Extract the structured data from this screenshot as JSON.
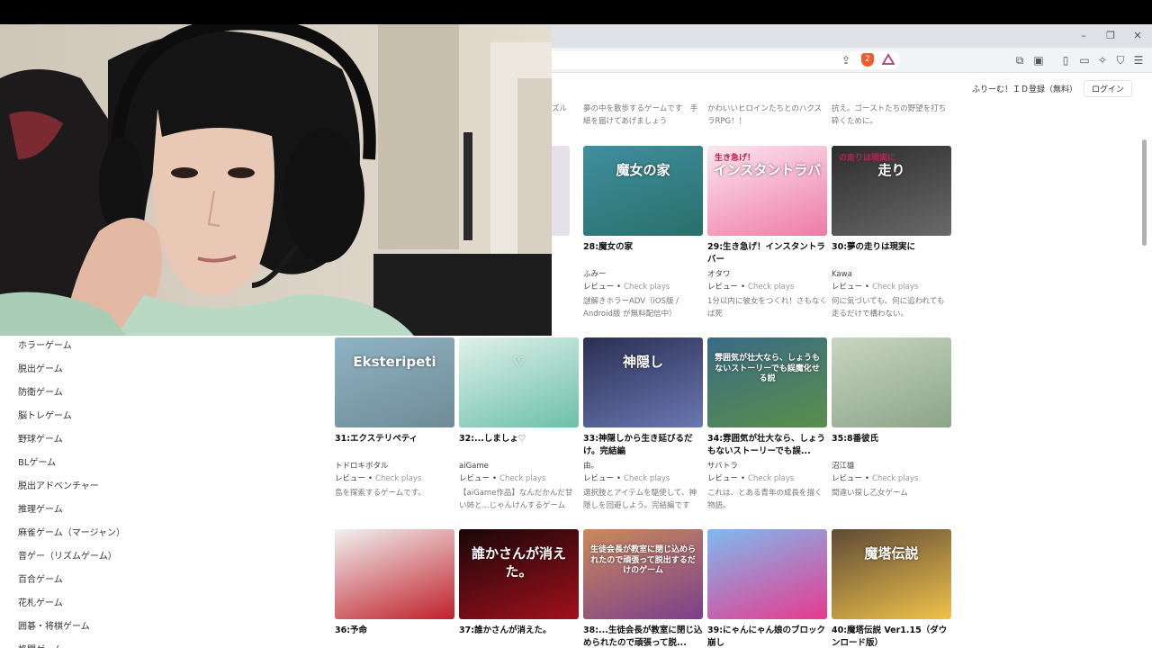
{
  "window_controls": {
    "minimize": "–",
    "maximize": "❐",
    "close": "✕"
  },
  "toolbar": {
    "brave_shield_count": "2",
    "icons": [
      "share-icon",
      "brave-shield-icon",
      "brave-rewards-icon",
      "extensions-icon",
      "reading-list-icon",
      "sidebar-icon",
      "wallet-icon",
      "leo-ai-icon",
      "vpn-icon",
      "menu-icon"
    ]
  },
  "site_header": {
    "register": "ふりーむ！ＩＤ登録（無料）",
    "login": "ログイン"
  },
  "sidebar": {
    "items": [
      "ホラーゲーム",
      "脱出ゲーム",
      "防衛ゲーム",
      "脳トレゲーム",
      "野球ゲーム",
      "BLゲーム",
      "脱出アドベンチャー",
      "推理ゲーム",
      "麻雀ゲーム（マージャン）",
      "音ゲー（リズムゲーム）",
      "百合ゲーム",
      "花札ゲーム",
      "囲碁・将棋ゲーム",
      "格闘ゲーム"
    ]
  },
  "top_row_descriptions": [
    {
      "text": "夢の中を散歩するゲームです　手紙を届けてあげましょう"
    },
    {
      "text": "かわいいヒロインたちとのハクスラRPG！！"
    },
    {
      "text": "抗え。ゴーストたちの野望を打ち砕くために。"
    }
  ],
  "partial_left": {
    "prefix": "ズル"
  },
  "review_label": "レビュー",
  "bullet": "•",
  "check_plays": "Check plays",
  "games": [
    {
      "title": "28:魔女の家",
      "author": "ふみー",
      "desc": "謎解きホラーADV（iOS版 / Android版 が無料配信中）",
      "thumb_text": "魔女の家",
      "bg": "#3f8fa0",
      "accent": "#2a6f6a"
    },
    {
      "title": "29:生き急げ！インスタントラバー",
      "author": "オタワ",
      "desc": "1分以内に彼女をつくれ！さもなくば死",
      "thumb_text": "インスタントラバ",
      "thumb_sub": "生き急げ！",
      "bg": "#fbe6ee",
      "accent": "#f07aa6"
    },
    {
      "title": "30:夢の走りは現実に",
      "author": "Kawa",
      "desc": "何に気づいても、何に追われても走るだけで構わない。",
      "thumb_text": "走り",
      "thumb_sub": "の走りは現実に",
      "bg": "#2c2c2c",
      "accent": "#6a6a6a"
    },
    {
      "title": "31:エクステリペティ",
      "author": "トドロキボタル",
      "desc": "島を探索するゲームです。",
      "thumb_text": "Eksteripeti",
      "bg": "#8fb3c4",
      "accent": "#6f8b97"
    },
    {
      "title": "32:...しましょ♡",
      "author": "aiGame",
      "desc": "【aiGame作品】なんだかんだ甘い姉と...じゃんけんするゲーム",
      "thumb_text": "♡",
      "bg": "#dff0ea",
      "accent": "#6cc0a8"
    },
    {
      "title": "33:神隠しから生き延びるだけ。完結編",
      "author": "由。",
      "desc": "選択肢とアイテムを駆使して、神隠しを回避しよう。完結編です",
      "thumb_text": "神隠し",
      "bg": "#2a2f52",
      "accent": "#6b77b3"
    },
    {
      "title": "34:雰囲気が壮大なら、しょうもないストーリーでも誤...",
      "author": "サバトラ",
      "desc": "これは、とある青年の成長を描く物語。",
      "thumb_text": "雰囲気が壮大なら、しょうもないストーリーでも誤魔化せる説",
      "bg": "#3a6a86",
      "accent": "#5a8f4a"
    },
    {
      "title": "35:8番彼氏",
      "author": "沼江雄",
      "desc": "間違い探し乙女ゲーム",
      "thumb_text": "",
      "bg": "#c8d5c2",
      "accent": "#8ca488"
    },
    {
      "title": "36:予命",
      "author": "",
      "desc": "",
      "thumb_text": "",
      "bg": "#f1f1f1",
      "accent": "#c0202a"
    },
    {
      "title": "37:誰かさんが消えた。",
      "author": "",
      "desc": "",
      "thumb_text": "誰かさんが消えた。",
      "bg": "#1a0608",
      "accent": "#a1101c"
    },
    {
      "title": "38:...生徒会長が教室に閉じ込められたので頑張って脱...",
      "author": "",
      "desc": "",
      "thumb_text": "生徒会長が教室に閉じ込められたので頑張って脱出するだけのゲーム",
      "bg": "#c98a5a",
      "accent": "#7c3f8c"
    },
    {
      "title": "39:にゃんにゃん娘のブロック崩し",
      "author": "",
      "desc": "",
      "thumb_text": "",
      "bg": "#7dbbf0",
      "accent": "#e73a8e"
    },
    {
      "title": "40:魔塔伝説 Ver1.15（ダウンロード版）",
      "author": "",
      "desc": "",
      "thumb_text": "魔塔伝説",
      "bg": "#5e4a36",
      "accent": "#f0c24a"
    }
  ],
  "colors": {
    "accent_link": "#333333",
    "brave_orange": "#f35a2c"
  }
}
